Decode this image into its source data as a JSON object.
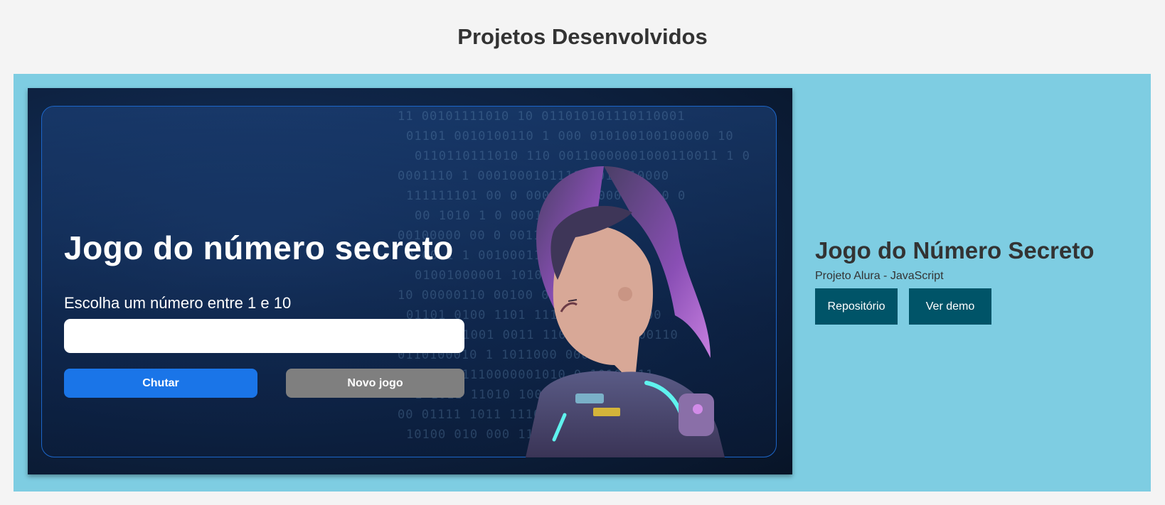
{
  "section": {
    "title": "Projetos Desenvolvidos"
  },
  "preview": {
    "title": "Jogo do número secreto",
    "prompt": "Escolha um número entre 1 e 10",
    "input_value": "",
    "guess_button": "Chutar",
    "new_game_button": "Novo jogo",
    "binary_rows": [
      "11 00101111010 10 011010101110110001",
      "01101 0010100110 1  000 010100100100000 10",
      "0110110111010 110   00110000001000110011 1 0",
      "0001110   1          0001000101111  1011010000",
      "111111101    00 0       0000011100000011 0 0",
      "00 1010           1   0     0001001 011",
      "00100000         00      0    0011  0   0",
      "0  00 1      1   0010001111   0 0   0",
      "01001000001         1010110100101 100",
      "10 00000110       00100  0011",
      "01101 0100   1101   1110 11111 01100",
      "1000 11001 0011   110 0011101000110",
      "0110100010 1        1011000 00000",
      "11010001110000001010    0 1010 011",
      "1   1011    11010 100 0  00",
      "00 01111  1011     1110 1 0",
      "10100 010   000  111   1 0"
    ],
    "colors": {
      "input": "#ffffff",
      "guess": "#1a75e8",
      "new_game": "#7f7f7f"
    }
  },
  "project": {
    "name": "Jogo do Número Secreto",
    "subtitle": "Projeto Alura - JavaScript",
    "repo_button": "Repositório",
    "demo_button": "Ver demo",
    "card_color": "#7ecde2",
    "button_color": "#005468"
  }
}
